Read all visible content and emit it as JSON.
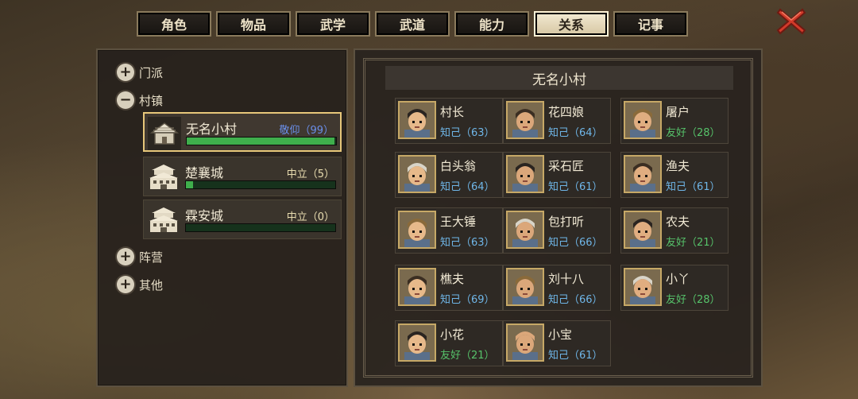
{
  "tabs": [
    {
      "label": "角色",
      "active": false
    },
    {
      "label": "物品",
      "active": false
    },
    {
      "label": "武学",
      "active": false
    },
    {
      "label": "武道",
      "active": false
    },
    {
      "label": "能力",
      "active": false
    },
    {
      "label": "关系",
      "active": true
    },
    {
      "label": "记事",
      "active": false
    }
  ],
  "close_icon": "close-x-icon",
  "colors": {
    "accent_gold": "#e7c77a",
    "zhiji": "#6fb6e8",
    "youhao": "#56c26a",
    "zhongli": "#e9ddb0",
    "jingyang": "#6a8ee8",
    "bar_green": "#3fae4c"
  },
  "tree": {
    "menpai": {
      "label": "门派",
      "toggle": "+"
    },
    "cunzhen": {
      "label": "村镇",
      "toggle": "−"
    },
    "zhenying": {
      "label": "阵营",
      "toggle": "+"
    },
    "qita": {
      "label": "其他",
      "toggle": "+"
    }
  },
  "villages": [
    {
      "name": "无名小村",
      "status": "敬仰（99）",
      "progress": 0.99,
      "icon": "hut-icon",
      "active": true
    },
    {
      "name": "楚襄城",
      "status": "中立（5）",
      "progress": 0.05,
      "icon": "city-gate-icon",
      "active": false
    },
    {
      "name": "霖安城",
      "status": "中立（0）",
      "progress": 0.0,
      "icon": "city-gate-icon",
      "active": false
    }
  ],
  "region_title": "无名小村",
  "npcs": [
    {
      "name": "村长",
      "relation": "知己（63）",
      "kind": "zhiji",
      "portrait": "elder-icon"
    },
    {
      "name": "花四娘",
      "relation": "知己（64）",
      "kind": "zhiji",
      "portrait": "woman-icon"
    },
    {
      "name": "屠户",
      "relation": "友好（28）",
      "kind": "youhao",
      "portrait": "butcher-icon"
    },
    {
      "name": "白头翁",
      "relation": "知己（64）",
      "kind": "zhiji",
      "portrait": "old-man-hat-icon"
    },
    {
      "name": "采石匠",
      "relation": "知己（61）",
      "kind": "zhiji",
      "portrait": "mason-icon"
    },
    {
      "name": "渔夫",
      "relation": "知己（61）",
      "kind": "zhiji",
      "portrait": "fisherman-icon"
    },
    {
      "name": "王大锤",
      "relation": "知己（63）",
      "kind": "zhiji",
      "portrait": "smith-icon"
    },
    {
      "name": "包打听",
      "relation": "知己（66）",
      "kind": "zhiji",
      "portrait": "informant-icon"
    },
    {
      "name": "农夫",
      "relation": "友好（21）",
      "kind": "youhao",
      "portrait": "farmer-icon"
    },
    {
      "name": "樵夫",
      "relation": "知己（69）",
      "kind": "zhiji",
      "portrait": "woodcutter-icon"
    },
    {
      "name": "刘十八",
      "relation": "知己（66）",
      "kind": "zhiji",
      "portrait": "lion-mask-icon"
    },
    {
      "name": "小丫",
      "relation": "友好（28）",
      "kind": "youhao",
      "portrait": "girl-icon"
    },
    {
      "name": "小花",
      "relation": "友好（21）",
      "kind": "youhao",
      "portrait": "flower-girl-icon"
    },
    {
      "name": "小宝",
      "relation": "知己（61）",
      "kind": "zhiji",
      "portrait": "bald-child-icon"
    }
  ]
}
